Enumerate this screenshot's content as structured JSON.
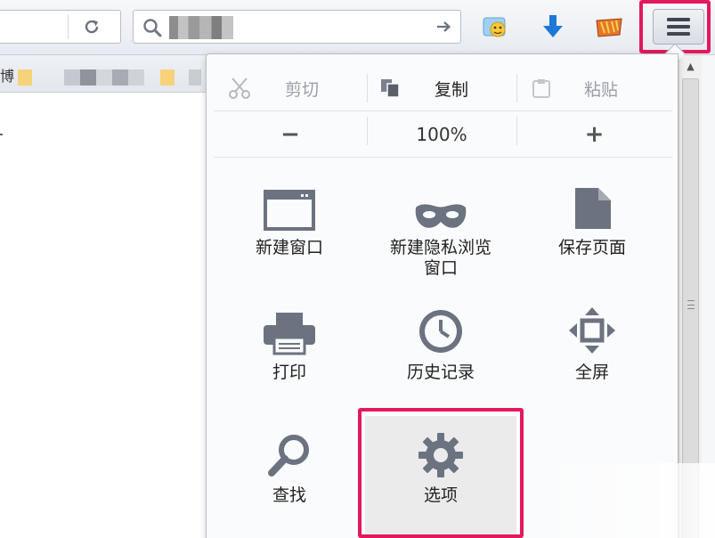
{
  "toolbar": {
    "reload_icon": "reload-icon",
    "search_icon": "search-icon",
    "go_icon": "arrow-right-icon",
    "addon_icon": "addon-icon",
    "download_icon": "download-arrow-icon",
    "extension_icon": "extension-icon",
    "menu_icon": "hamburger-menu-icon"
  },
  "bookmarks": {
    "first_label": "博"
  },
  "menu": {
    "edit": {
      "cut": "剪切",
      "copy": "复制",
      "paste": "粘贴"
    },
    "zoom": {
      "out": "−",
      "level": "100%",
      "in": "+"
    },
    "items": [
      {
        "label": "新建窗口",
        "icon": "new-window-icon"
      },
      {
        "label": "新建隐私浏览\n窗口",
        "label_line1": "新建隐私浏览",
        "label_line2": "窗口",
        "icon": "private-mask-icon"
      },
      {
        "label": "保存页面",
        "icon": "save-page-icon"
      },
      {
        "label": "打印",
        "icon": "printer-icon"
      },
      {
        "label": "历史记录",
        "icon": "history-clock-icon"
      },
      {
        "label": "全屏",
        "icon": "fullscreen-icon"
      },
      {
        "label": "查找",
        "icon": "magnifier-icon"
      },
      {
        "label": "选项",
        "icon": "gear-icon"
      }
    ]
  },
  "colors": {
    "highlight": "#e2195c",
    "icon_gray": "#6b7380",
    "download_blue": "#1e78d8"
  }
}
